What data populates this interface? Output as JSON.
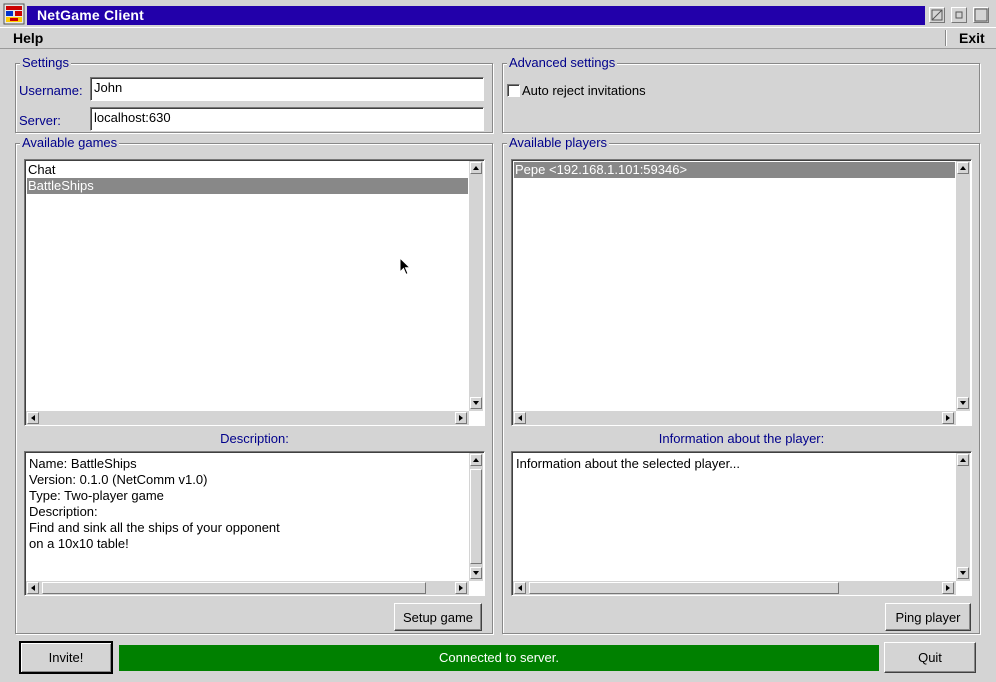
{
  "window": {
    "title": "NetGame Client"
  },
  "menu": {
    "help_label": "Help",
    "exit_label": "Exit"
  },
  "settings": {
    "legend": "Settings",
    "username_label": "Username:",
    "username_value": "John",
    "server_label": "Server:",
    "server_value": "localhost:630"
  },
  "advanced": {
    "legend": "Advanced settings",
    "auto_reject_label": "Auto reject invitations",
    "auto_reject_checked": false
  },
  "games": {
    "legend": "Available games",
    "items": [
      {
        "label": "Chat",
        "selected": false
      },
      {
        "label": "BattleShips",
        "selected": true
      }
    ],
    "description_label": "Description:",
    "description_lines": [
      "Name: BattleShips",
      "Version: 0.1.0 (NetComm v1.0)",
      "Type: Two-player game",
      "Description:",
      "Find and sink all the ships of your opponent",
      "on a 10x10 table!"
    ],
    "setup_button": "Setup game"
  },
  "players": {
    "legend": "Available players",
    "items": [
      {
        "label": "Pepe <192.168.1.101:59346>",
        "selected": true
      }
    ],
    "info_label": "Information about the player:",
    "info_lines": [
      "Information about the selected player..."
    ],
    "ping_button": "Ping player"
  },
  "footer": {
    "invite_button": "Invite!",
    "status_text": "Connected to server.",
    "quit_button": "Quit"
  },
  "colors": {
    "title_bar": "#2200aa",
    "status_ok": "#008000",
    "label_blue": "#00008b",
    "selection": "#888888"
  }
}
